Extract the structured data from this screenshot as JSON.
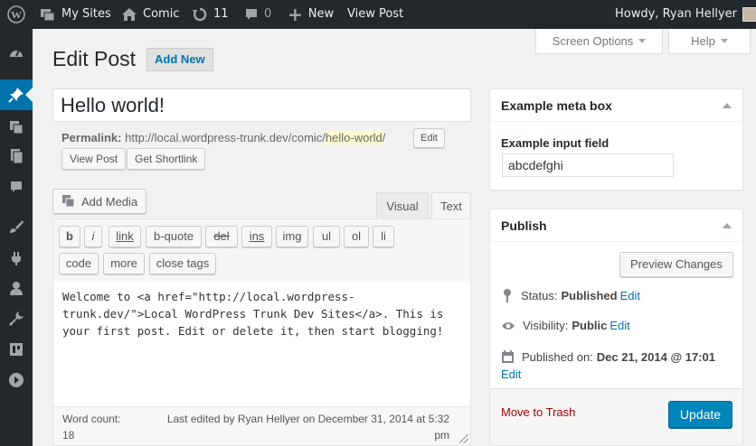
{
  "adminbar": {
    "my_sites": "My Sites",
    "site_name": "Comic",
    "updates_count": "11",
    "comments_count": "0",
    "new_label": "New",
    "view_post": "View Post",
    "howdy": "Howdy, Ryan Hellyer"
  },
  "screen_options": {
    "screen_options_label": "Screen Options",
    "help_label": "Help"
  },
  "page": {
    "title": "Edit Post",
    "add_new": "Add New"
  },
  "post": {
    "title": "Hello world!",
    "permalink_label": "Permalink:",
    "permalink_base": "http://local.wordpress-trunk.dev/comic/",
    "permalink_slug": "hello-world",
    "permalink_trailing": "/",
    "edit_slug": "Edit",
    "view_post": "View Post",
    "get_shortlink": "Get Shortlink"
  },
  "editor": {
    "add_media": "Add Media",
    "tab_visual": "Visual",
    "tab_text": "Text",
    "quicktags": [
      "b",
      "i",
      "link",
      "b-quote",
      "del",
      "ins",
      "img",
      "ul",
      "ol",
      "li",
      "code",
      "more",
      "close tags"
    ],
    "content_lines": [
      "Welcome to <a href=\"http://local.wordpress-",
      "trunk.dev/\">Local WordPress Trunk Dev Sites</a>. This is",
      "your first post. Edit or delete it, then start blogging!"
    ],
    "word_count_label": "Word count:",
    "word_count": "18",
    "last_edited_line1": "Last edited by Ryan Hellyer on December 31, 2014 at 5:32",
    "last_edited_line2": "pm"
  },
  "metabox": {
    "title": "Example meta box",
    "field_label": "Example input field",
    "field_value": "abcdefghi"
  },
  "publish": {
    "title": "Publish",
    "preview_changes": "Preview Changes",
    "status_label": "Status:",
    "status_value": "Published",
    "visibility_label": "Visibility:",
    "visibility_value": "Public",
    "published_on_label": "Published on:",
    "published_on_value": "Dec 21, 2014 @ 17:01",
    "edit": "Edit",
    "move_to_trash": "Move to Trash",
    "update": "Update"
  },
  "colors": {
    "accent": "#0073aa",
    "adminbar": "#23282d",
    "trash": "#a00",
    "update_button": "#0085ba"
  }
}
